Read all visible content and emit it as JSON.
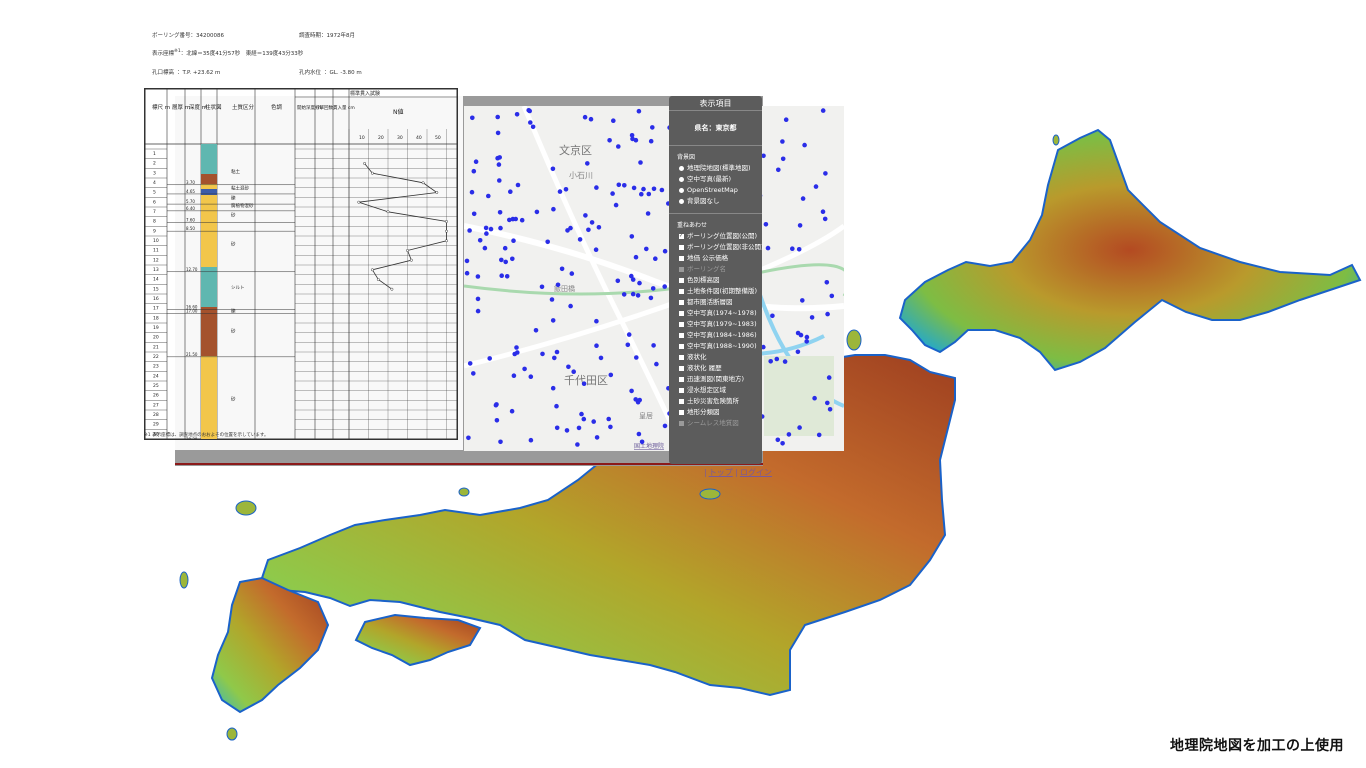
{
  "boring_log": {
    "boring_no_label": "ボーリング番号：",
    "boring_no": "34200086",
    "survey_period_label": "調査時期：",
    "survey_period": "1972年8月",
    "coords_label": "表示座標",
    "coords_note": "※1",
    "coords_value": "：北緯＝35度41分57秒　東経＝139度43分33秒",
    "elevation_label": "孔口標高",
    "elevation_value": "：T.P. +23.62 m",
    "water_label": "孔内水位",
    "water_value": "：GL. -3.80 m",
    "columns": [
      "標尺 m",
      "層厚 m",
      "深度 m",
      "柱状図",
      "土質区分",
      "色調",
      "記事"
    ],
    "spt_title": "標準貫入試験",
    "spt_sub": [
      "開始深度 m",
      "打撃回数",
      "貫入量 cm"
    ],
    "n_value_label": "N値",
    "n_axis": [
      "10",
      "20",
      "30",
      "40",
      "50"
    ],
    "depth_ticks": [
      "1",
      "2",
      "3",
      "4",
      "5",
      "6",
      "7",
      "8",
      "9",
      "10",
      "11",
      "12",
      "13",
      "14",
      "15",
      "16",
      "17",
      "18",
      "19",
      "20",
      "21",
      "22",
      "23",
      "24",
      "25",
      "26",
      "27",
      "28",
      "29",
      "30"
    ],
    "layer_depths": [
      "3.70",
      "4.65",
      "5.70",
      "6.40",
      "7.60",
      "8.50",
      "12.70",
      "16.60",
      "17.00",
      "21.50",
      "30.30"
    ],
    "soil_labels": [
      "粘土",
      "粘土混砂",
      "礫",
      "腐植物混砂",
      "砂",
      "砂",
      "シルト",
      "砂",
      "礫",
      "砂"
    ],
    "footnote": "※1 表示座標は、調査地点のおおよその位置を示しています。",
    "n_values": [
      8,
      12,
      38,
      45,
      5,
      20,
      50,
      50,
      50,
      30,
      32,
      12,
      15,
      22
    ]
  },
  "map": {
    "district_labels": [
      "文京区",
      "小石川",
      "飯田橋",
      "千代田区",
      "皇居"
    ],
    "attribution": "国土地理院",
    "links": [
      "トップ",
      "ログイン"
    ]
  },
  "panel": {
    "title": "表示項目",
    "prefecture": "県名：東京都",
    "background_label": "背景図",
    "background_options": [
      "地理院地図(標準地図)",
      "空中写真(最新)",
      "OpenStreetMap",
      "背景図なし"
    ],
    "overlay_label": "重ねあわせ",
    "overlay_options": [
      {
        "label": "ボーリング位置図(公開)",
        "checked": true,
        "dim": false
      },
      {
        "label": "ボーリング位置図(非公開)",
        "checked": false,
        "dim": false
      },
      {
        "label": "地価 公示価格",
        "checked": false,
        "dim": false
      },
      {
        "label": "ボーリング名",
        "checked": false,
        "dim": true
      },
      {
        "label": "色別標高図",
        "checked": false,
        "dim": false
      },
      {
        "label": "土地条件図(初期整備版)",
        "checked": false,
        "dim": false
      },
      {
        "label": "都市圏活断層図",
        "checked": false,
        "dim": false
      },
      {
        "label": "空中写真(1974~1978)",
        "checked": false,
        "dim": false
      },
      {
        "label": "空中写真(1979~1983)",
        "checked": false,
        "dim": false
      },
      {
        "label": "空中写真(1984~1986)",
        "checked": false,
        "dim": false
      },
      {
        "label": "空中写真(1988~1990)",
        "checked": false,
        "dim": false
      },
      {
        "label": "液状化",
        "checked": false,
        "dim": false
      },
      {
        "label": "液状化 履歴",
        "checked": false,
        "dim": false
      },
      {
        "label": "迅速測図(関東地方)",
        "checked": false,
        "dim": false
      },
      {
        "label": "浸水想定区域",
        "checked": false,
        "dim": false
      },
      {
        "label": "土砂災害危険箇所",
        "checked": false,
        "dim": false
      },
      {
        "label": "地形分類図",
        "checked": false,
        "dim": false
      },
      {
        "label": "シームレス地質図",
        "checked": false,
        "dim": true
      }
    ]
  },
  "credit": "地理院地図を加工の上使用"
}
